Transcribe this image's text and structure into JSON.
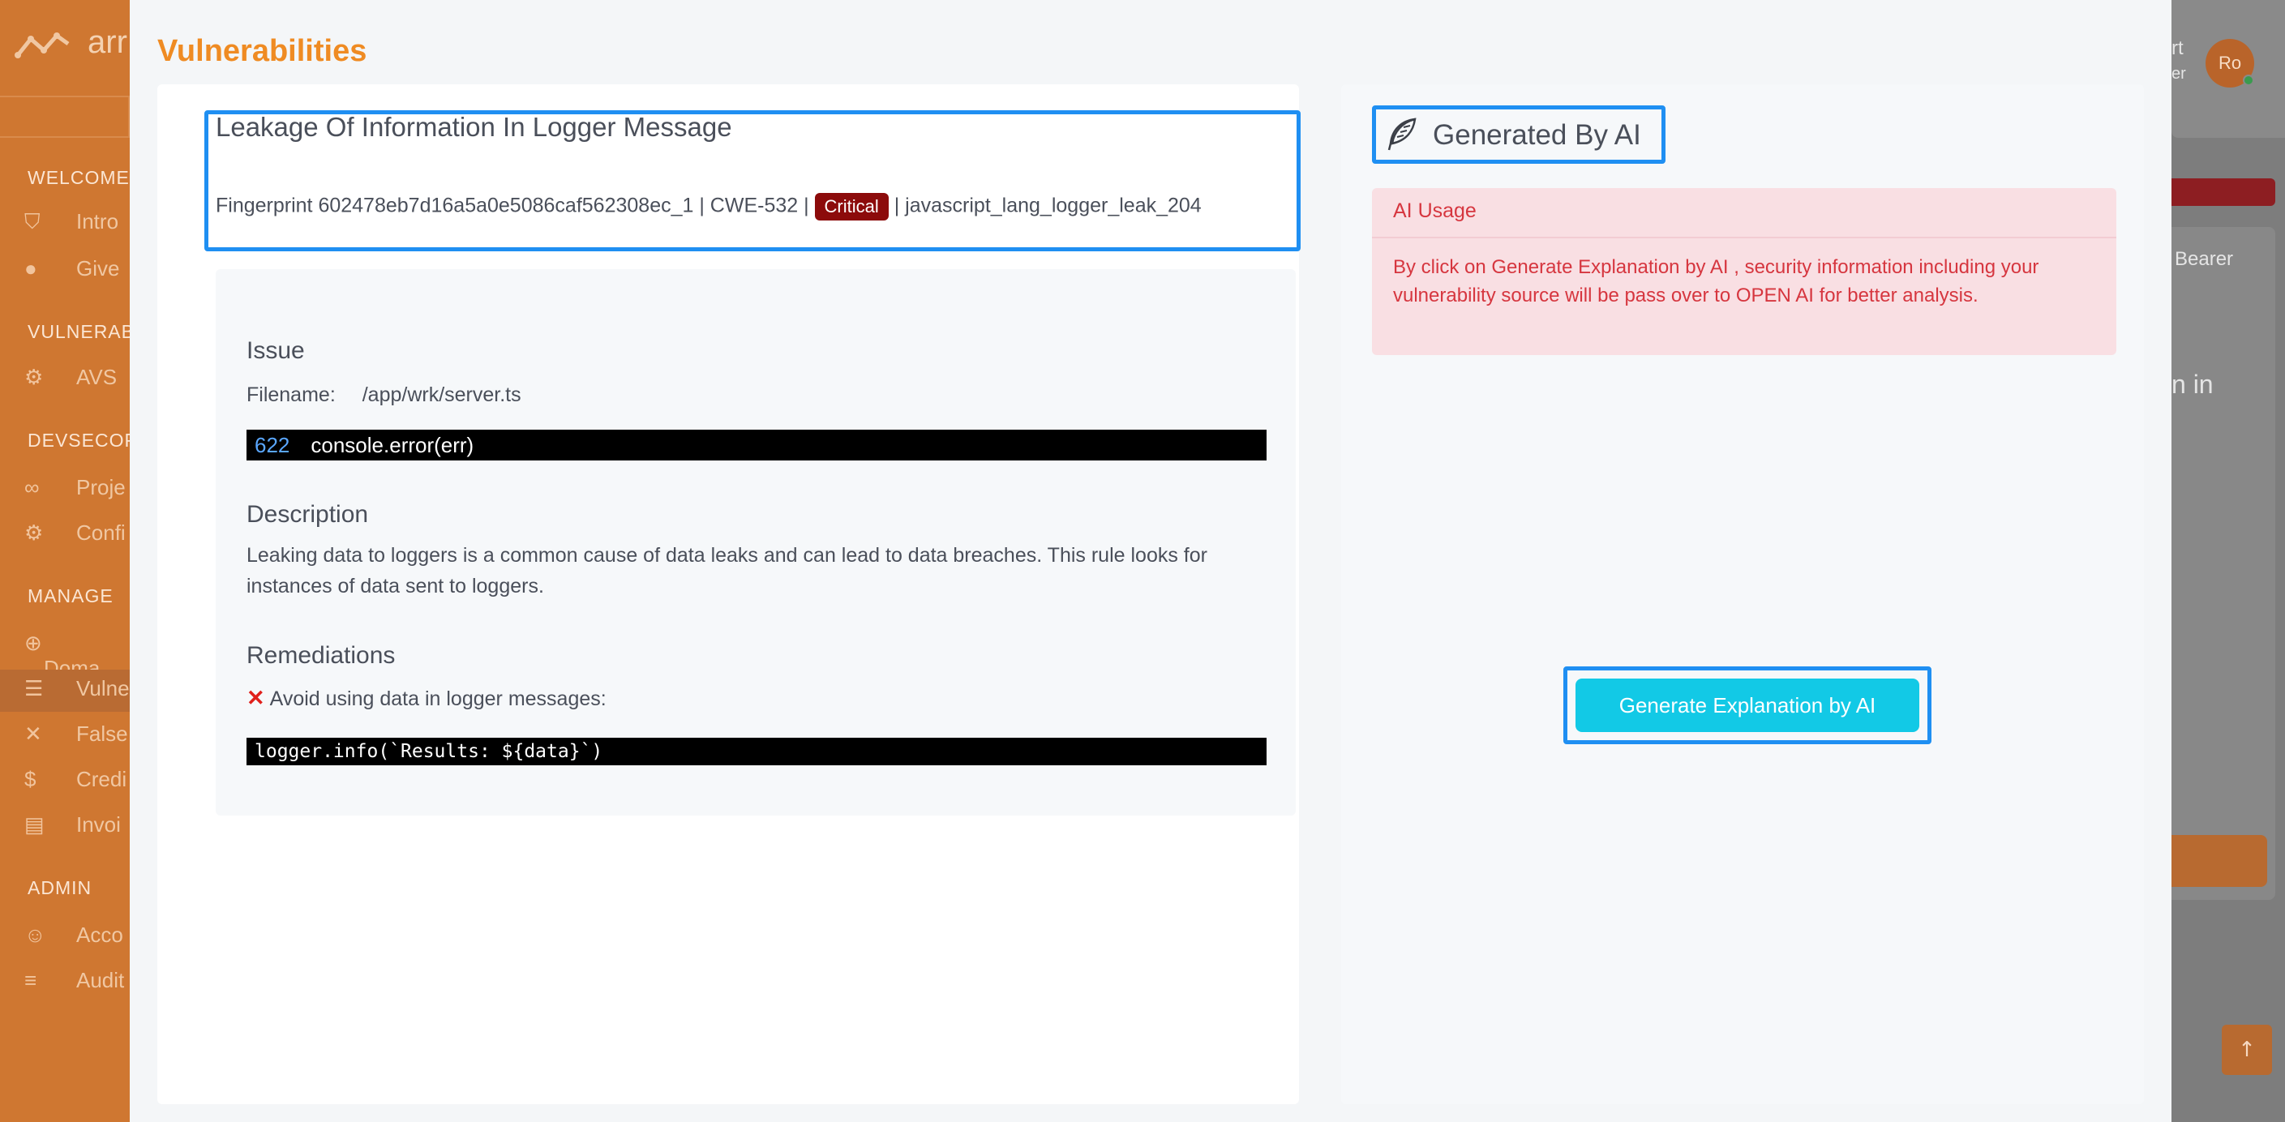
{
  "background_app": {
    "logo_text": "arr",
    "sidebar_sections": [
      {
        "title": "WELCOME",
        "items": [
          {
            "label": "Intro",
            "icon": "shield-icon"
          },
          {
            "label": "Give",
            "icon": "chat-icon"
          }
        ]
      },
      {
        "title": "VULNERABI",
        "items": [
          {
            "label": "AVS",
            "icon": "chip-icon"
          }
        ]
      },
      {
        "title": "DEVSECOP",
        "items": [
          {
            "label": "Proje",
            "icon": "infinity-icon"
          },
          {
            "label": "Confi",
            "icon": "gear-icon"
          }
        ]
      },
      {
        "title": "MANAGE",
        "items": [
          {
            "label": "Doma",
            "icon": "plus-circle-icon"
          },
          {
            "label": "Vulne",
            "icon": "list-check-icon"
          },
          {
            "label": "False",
            "icon": "x-icon"
          },
          {
            "label": "Credi",
            "icon": "dollar-icon"
          },
          {
            "label": "Invoi",
            "icon": "file-icon"
          }
        ]
      },
      {
        "title": "ADMIN",
        "items": [
          {
            "label": "Acco",
            "icon": "users-icon"
          },
          {
            "label": "Audit",
            "icon": "list-icon"
          }
        ]
      }
    ],
    "right_texts": [
      "rt",
      "er",
      "Bearer",
      "n in"
    ],
    "avatar_initials": "Ro",
    "scroll_top_icon": "arrow-up-icon"
  },
  "modal": {
    "title": "Vulnerabilities",
    "vulnerability": {
      "title": "Leakage Of Information In Logger Message",
      "fingerprint_prefix": "Fingerprint 602478eb7d16a5a0e5086caf562308ec_1 | CWE-532 |",
      "severity": "Critical",
      "rule_suffix": "| javascript_lang_logger_leak_204"
    },
    "issue": {
      "heading": "Issue",
      "filename_label": "Filename:",
      "filename_value": "/app/wrk/server.ts",
      "line_number": "622",
      "code": "console.error(err)"
    },
    "description": {
      "heading": "Description",
      "text": "Leaking data to loggers is a common cause of data leaks and can lead to data breaches. This rule looks for instances of data sent to loggers."
    },
    "remediations": {
      "heading": "Remediations",
      "item": "Avoid using data in logger messages:",
      "code": "logger.info(`Results: ${data}`)"
    },
    "ai_panel": {
      "title": "Generated By AI",
      "icon": "feather-icon",
      "alert_title": "AI Usage",
      "alert_text": "By click on Generate Explanation by AI , security information including your vulnerability source will be pass over to OPEN AI for better analysis.",
      "button_label": "Generate Explanation by AI"
    }
  },
  "colors": {
    "accent_title": "#ef8b23",
    "highlight_border": "#1f8ff2",
    "critical_badge": "#8c0b0b",
    "alert_text": "#d6363f",
    "alert_bg": "#f9dfe3",
    "button": "#12c9e6"
  }
}
